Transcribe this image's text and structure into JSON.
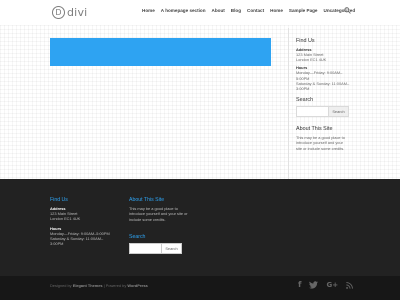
{
  "header": {
    "logo_mark": "D",
    "logo_text": "divi",
    "nav": [
      "Home",
      "A homepage section",
      "About",
      "Blog",
      "Contact",
      "Home",
      "Sample Page",
      "Uncategorized"
    ]
  },
  "main": {
    "accent_color": "#2ea3f2"
  },
  "sidebar": {
    "find_title": "Find Us",
    "address_label": "Address",
    "address_line1": "123 Main Street",
    "address_line2": "London EC1 4UK",
    "hours_label": "Hours",
    "hours_line1": "Monday—Friday: 9:00AM–",
    "hours_line2": "5:00PM",
    "hours_line3": "Saturday & Sunday: 11:00AM–",
    "hours_line4": "3:00PM",
    "search_title": "Search",
    "search_button": "Search",
    "about_title": "About This Site",
    "about_line1": "This may be a good place to",
    "about_line2": "introduce yourself and your",
    "about_line3": "site or include some credits."
  },
  "footer": {
    "find_title": "Find Us",
    "address_label": "Address",
    "address_line1": "123 Main Street",
    "address_line2": "London EC1 4UK",
    "hours_label": "Hours",
    "hours_line1": "Monday—Friday: 9:00AM–5:00PM",
    "hours_line2": "Saturday & Sunday: 11:00AM–",
    "hours_line3": "3:00PM",
    "about_title": "About This Site",
    "about_line1": "This may be a good place to",
    "about_line2": "introduce yourself and your site or",
    "about_line3": "include some credits.",
    "search_title": "Search",
    "search_button": "Search",
    "credits_prefix": "Designed by ",
    "credits_brand1": "Elegant Themes",
    "credits_mid": " | Powered by ",
    "credits_brand2": "WordPress",
    "social_icons": [
      "facebook-icon",
      "twitter-icon",
      "google-plus-icon",
      "rss-icon"
    ]
  }
}
